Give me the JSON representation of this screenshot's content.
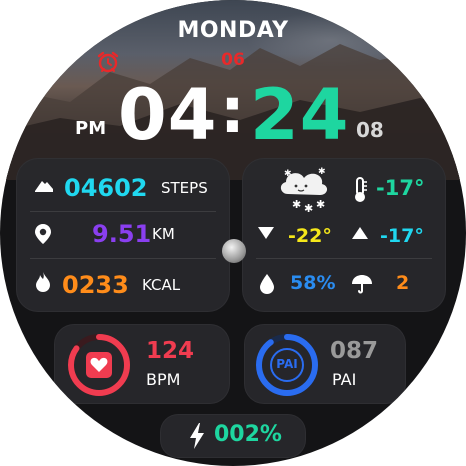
{
  "header": {
    "day": "MONDAY",
    "date": "06",
    "alarm_icon": "alarm-clock-icon"
  },
  "time": {
    "ampm": "PM",
    "hours": "04",
    "colon": ":",
    "minutes": "24",
    "seconds": "08"
  },
  "stats": {
    "steps": {
      "value": "04602",
      "unit": "STEPS",
      "icon": "shoe-icon"
    },
    "distance": {
      "value": "9.51",
      "unit": "KM",
      "icon": "location-pin-icon"
    },
    "calories": {
      "value": "0233",
      "unit": "KCAL",
      "icon": "flame-icon"
    }
  },
  "weather": {
    "icon": "snow-cloud-icon",
    "current_temp": "-17°",
    "low_temp": "-22°",
    "high_temp": "-17°",
    "humidity": "58%",
    "uv_index": "2"
  },
  "heart": {
    "value": "124",
    "unit": "BPM",
    "ring_fraction": 0.85
  },
  "pai": {
    "label": "PAI",
    "value": "087",
    "unit": "PAI",
    "ring_fraction": 0.9
  },
  "battery": {
    "value": "002%"
  },
  "colors": {
    "accent_teal": "#1ed6a0",
    "cyan": "#20d8f0",
    "purple": "#8a3ff0",
    "orange": "#ff8c1a",
    "yellow": "#f5e71a",
    "red": "#f03c50",
    "blue": "#2a6cf0",
    "alarm_red": "#e8292a"
  }
}
